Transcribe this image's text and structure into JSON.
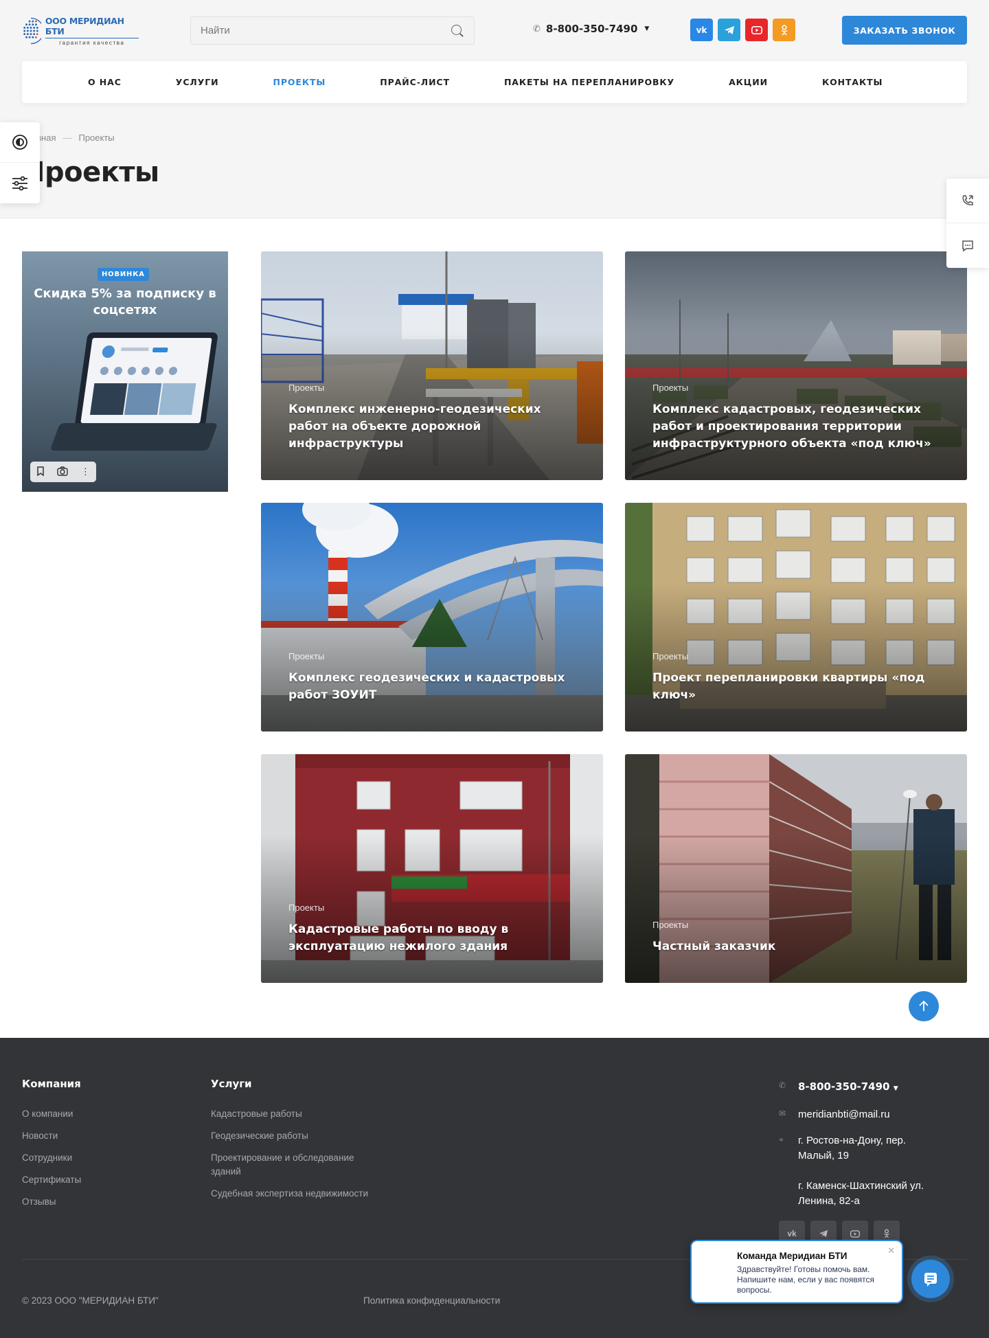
{
  "header": {
    "logo_name": "ООО МЕРИДИАН БТИ",
    "logo_tagline": "гарантия качества",
    "search_placeholder": "Найти",
    "phone": "8-800-350-7490",
    "socials": [
      "vk",
      "telegram",
      "youtube",
      "odnoklassniki"
    ],
    "call_button": "ЗАКАЗАТЬ ЗВОНОК"
  },
  "nav": [
    {
      "label": "О НАС",
      "active": false
    },
    {
      "label": "УСЛУГИ",
      "active": false
    },
    {
      "label": "ПРОЕКТЫ",
      "active": true
    },
    {
      "label": "ПРАЙС-ЛИСТ",
      "active": false
    },
    {
      "label": "ПАКЕТЫ НА ПЕРЕПЛАНИРОВКУ",
      "active": false
    },
    {
      "label": "АКЦИИ",
      "active": false
    },
    {
      "label": "КОНТАКТЫ",
      "active": false
    }
  ],
  "breadcrumbs": {
    "home": "Главная",
    "current": "Проекты"
  },
  "page_title": "Проекты",
  "promo": {
    "badge": "НОВИНКА",
    "title": "Скидка 5% за подписку в соцсетях"
  },
  "cards": [
    {
      "category": "Проекты",
      "title": "Комплекс инженерно-геодезических работ на объекте дорожной инфраструктуры"
    },
    {
      "category": "Проекты",
      "title": "Комплекс кадастровых, геодезических работ и проектирования территории инфраструктурного объекта «под ключ»"
    },
    {
      "category": "Проекты",
      "title": "Комплекс геодезических и кадастровых работ ЗОУИТ"
    },
    {
      "category": "Проекты",
      "title": "Проект перепланировки квартиры «под ключ»"
    },
    {
      "category": "Проекты",
      "title": "Кадастровые работы по вводу в эксплуатацию нежилого здания"
    },
    {
      "category": "Проекты",
      "title": "Частный заказчик"
    }
  ],
  "footer": {
    "company_heading": "Компания",
    "company_links": [
      "О компании",
      "Новости",
      "Сотрудники",
      "Сертификаты",
      "Отзывы"
    ],
    "services_heading": "Услуги",
    "services_links": [
      "Кадастровые работы",
      "Геодезические работы",
      "Проектирование и обследование зданий",
      "Судебная экспертиза недвижимости"
    ],
    "phone": "8-800-350-7490",
    "email": "meridianbti@mail.ru",
    "address_1": "г. Ростов-на-Дону, пер. Малый, 19",
    "address_2": "г. Каменск-Шахтинский ул. Ленина, 82-а",
    "copyright": "© 2023 ООО \"МЕРИДИАН БТИ\"",
    "privacy": "Политика конфиденциальности"
  },
  "chat": {
    "title": "Команда Меридиан БТИ",
    "text": "Здравствуйте! Готовы помочь вам. Напишите нам, если у вас появятся вопросы."
  },
  "colors": {
    "accent": "#2d88d9",
    "footer_bg": "#333437",
    "page_bg": "#f5f5f6"
  }
}
